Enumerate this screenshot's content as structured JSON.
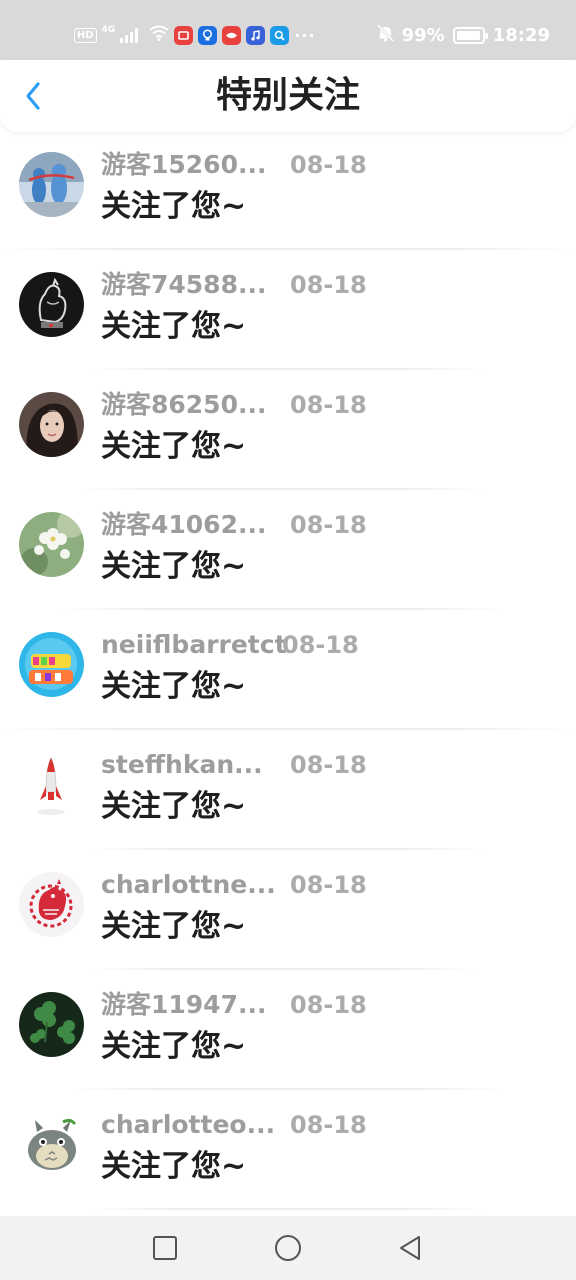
{
  "status_bar": {
    "hd": "HD",
    "network": "4G",
    "battery_text": "99%",
    "battery_level": 0.99,
    "time": "18:29",
    "more": "···",
    "icons": [
      "signal-icon",
      "wifi-icon",
      "red-app-icon",
      "blue-bulb-app-icon",
      "red-video-app-icon",
      "music-app-icon",
      "search-app-icon",
      "mute-bell-icon",
      "battery-icon"
    ]
  },
  "header": {
    "title": "特别关注",
    "back_icon": "chevron-left-icon",
    "accent": "#2a9df4"
  },
  "notifications": [
    {
      "name": "游客15260...",
      "date": "08-18",
      "message": "关注了您~",
      "avatar": "blue-figure-avatar"
    },
    {
      "name": "游客74588...",
      "date": "08-18",
      "message": "关注了您~",
      "avatar": "glass-rooster-avatar"
    },
    {
      "name": "游客86250...",
      "date": "08-18",
      "message": "关注了您~",
      "avatar": "woman-portrait-avatar"
    },
    {
      "name": "游客41062...",
      "date": "08-18",
      "message": "关注了您~",
      "avatar": "white-flowers-avatar"
    },
    {
      "name": "neiiflbarretct",
      "date": "08-18",
      "message": "关注了您~",
      "avatar": "new-year-avatar"
    },
    {
      "name": "steffhkan...",
      "date": "08-18",
      "message": "关注了您~",
      "avatar": "rocket-avatar"
    },
    {
      "name": "charlottne...",
      "date": "08-18",
      "message": "关注了您~",
      "avatar": "papercut-rooster-avatar"
    },
    {
      "name": "游客11947...",
      "date": "08-18",
      "message": "关注了您~",
      "avatar": "clover-avatar"
    },
    {
      "name": "charlotteo...",
      "date": "08-18",
      "message": "关注了您~",
      "avatar": "totoro-avatar"
    }
  ],
  "nav_bar": {
    "icons": [
      "recent-apps-square-icon",
      "home-circle-icon",
      "back-triangle-icon"
    ]
  }
}
